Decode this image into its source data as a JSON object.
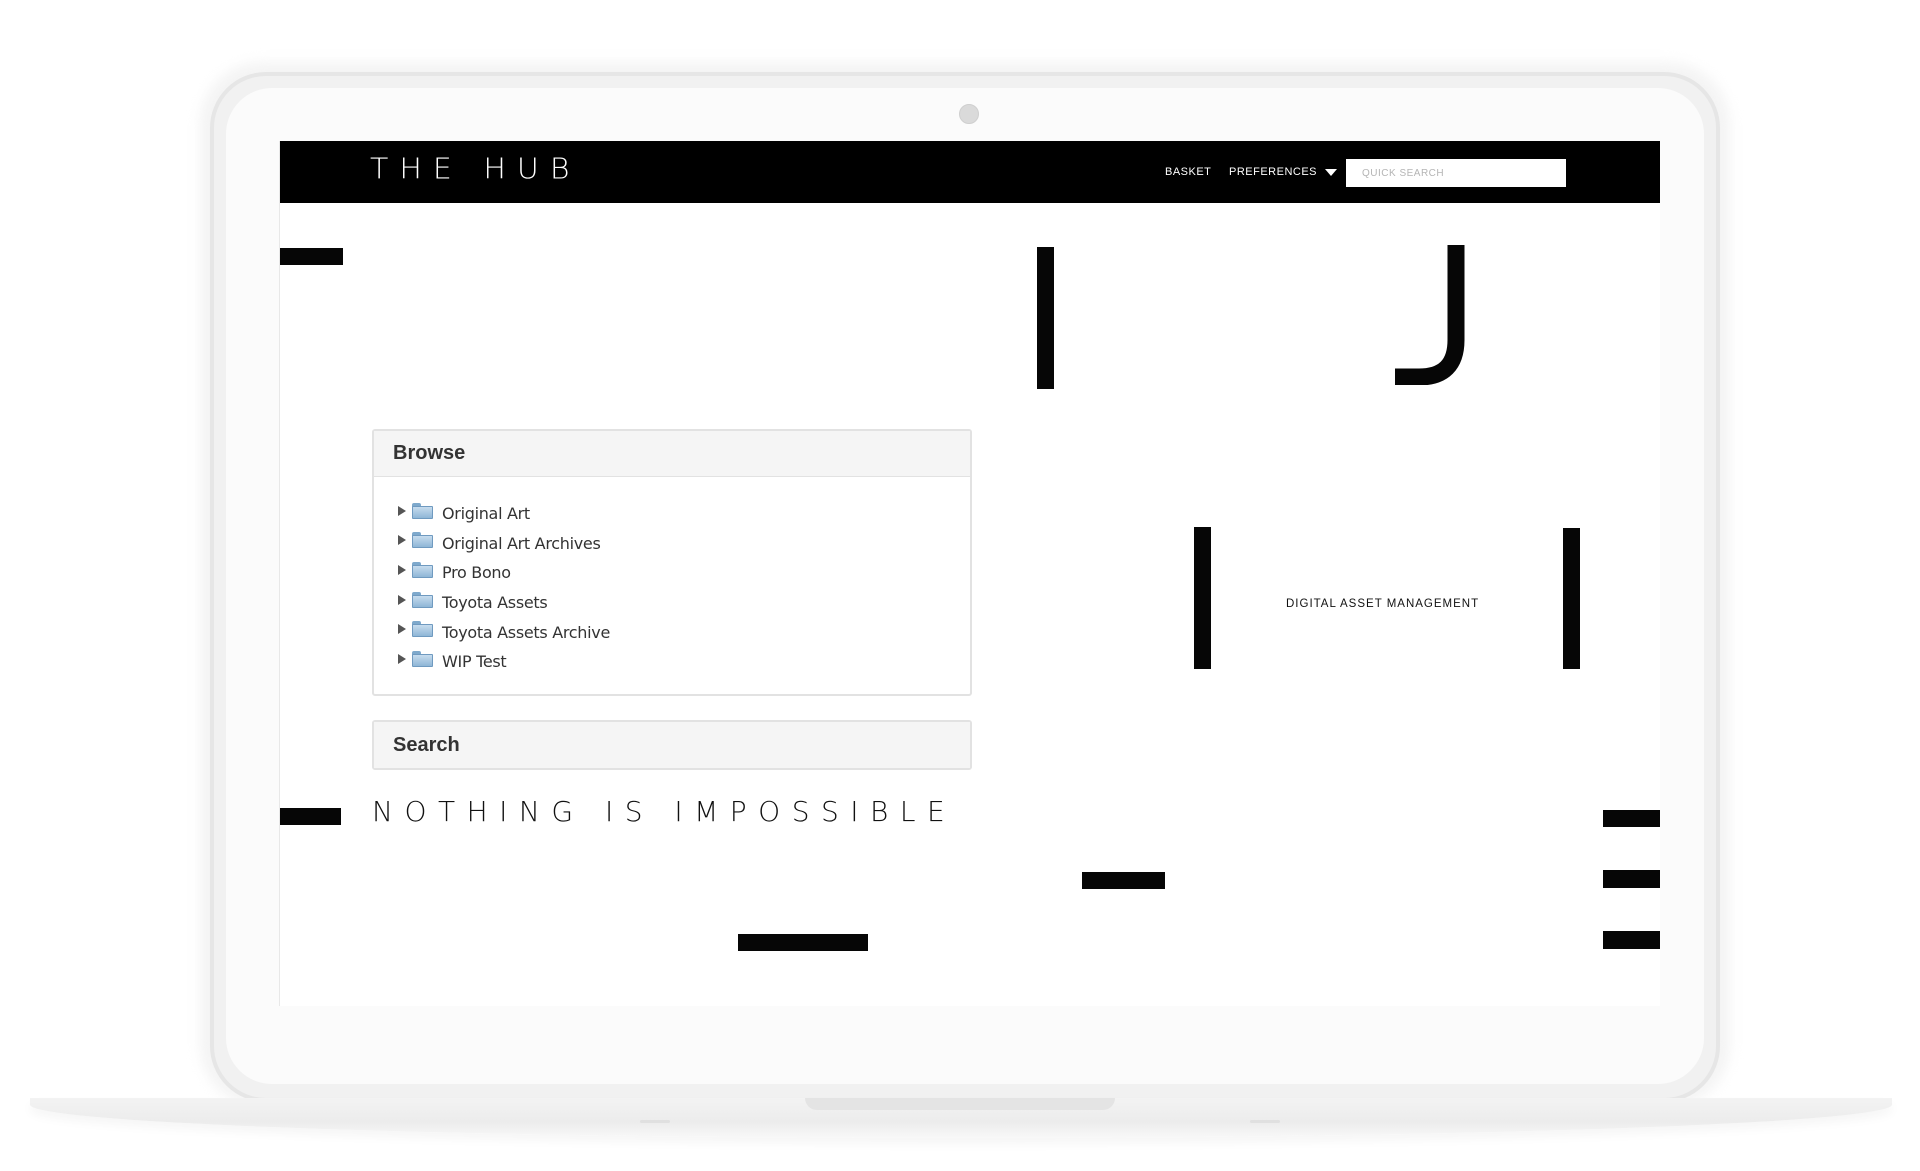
{
  "header": {
    "logo": "THE HUB",
    "nav": {
      "basket": "BASKET",
      "preferences": "PREFERENCES"
    },
    "search": {
      "placeholder": "QUICK SEARCH",
      "value": ""
    }
  },
  "browse": {
    "title": "Browse",
    "folders": [
      "Original Art",
      "Original Art Archives",
      "Pro Bono",
      "Toyota Assets",
      "Toyota Assets Archive",
      "WIP Test"
    ]
  },
  "search_panel": {
    "title": "Search"
  },
  "tagline": "NOTHING IS IMPOSSIBLE",
  "subtitle": "DIGITAL ASSET MANAGEMENT",
  "icons": {
    "tree_toggle": "triangle-right-icon",
    "folder": "folder-icon",
    "preferences_caret": "caret-down-icon"
  },
  "colors": {
    "topbar": "#000000",
    "accent_bars": "#060606",
    "panel_heading": "#f5f5f5",
    "folder": "#8fb6d6"
  }
}
